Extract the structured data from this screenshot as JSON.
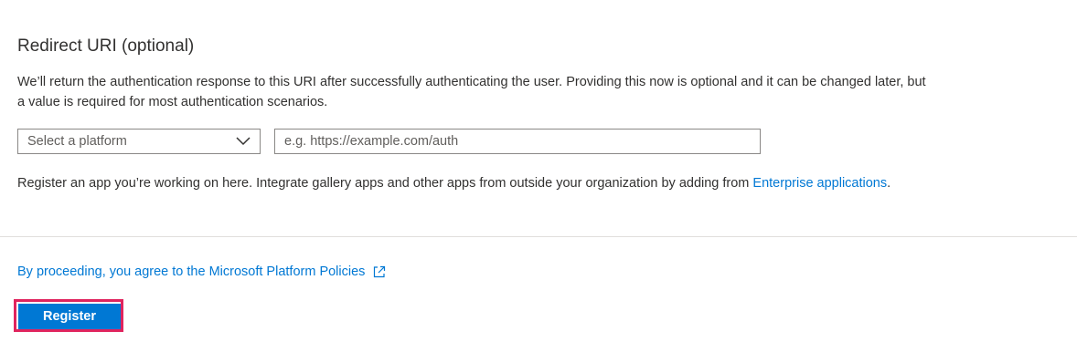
{
  "redirect_uri": {
    "title": "Redirect URI (optional)",
    "description": "We’ll return the authentication response to this URI after successfully authenticating the user. Providing this now is optional and it can be changed later, but a value is required for most authentication scenarios.",
    "platform_select": {
      "selected": "Select a platform",
      "icon": "chevron-down-icon"
    },
    "uri_input": {
      "value": "",
      "placeholder": "e.g. https://example.com/auth"
    }
  },
  "register_info": {
    "text": "Register an app you’re working on here. Integrate gallery apps and other apps from outside your organization by adding from ",
    "link_text": "Enterprise applications",
    "suffix": "."
  },
  "footer": {
    "policy_link": "By proceeding, you agree to the Microsoft Platform Policies",
    "policy_icon": "external-link-icon",
    "register_label": "Register"
  },
  "colors": {
    "accent": "#0078d4",
    "highlight": "#e0245e",
    "text": "#323130",
    "border": "#8a8886",
    "divider": "#e1dfdd"
  }
}
